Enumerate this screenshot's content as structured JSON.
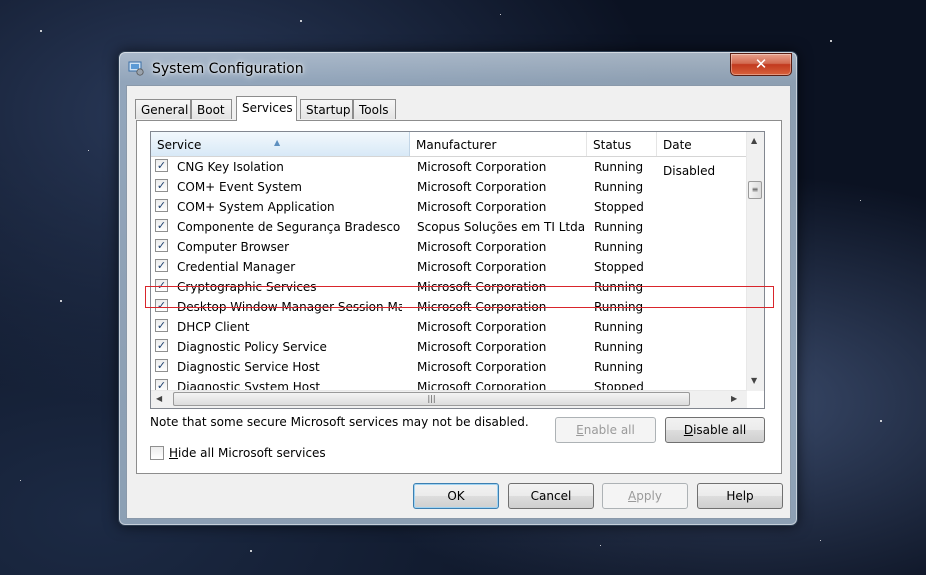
{
  "window": {
    "title": "System Configuration",
    "close_symbol": "✕"
  },
  "tabs": [
    {
      "label": "General",
      "active": false
    },
    {
      "label": "Boot",
      "active": false
    },
    {
      "label": "Services",
      "active": true
    },
    {
      "label": "Startup",
      "active": false
    },
    {
      "label": "Tools",
      "active": false
    }
  ],
  "table": {
    "columns": [
      "Service",
      "Manufacturer",
      "Status",
      "Date Disabled"
    ],
    "sorted_column": "Service",
    "rows": [
      {
        "service": "CNG Key Isolation",
        "manufacturer": "Microsoft Corporation",
        "status": "Running",
        "date_disabled": "",
        "checked": true
      },
      {
        "service": "COM+ Event System",
        "manufacturer": "Microsoft Corporation",
        "status": "Running",
        "date_disabled": "",
        "checked": true
      },
      {
        "service": "COM+ System Application",
        "manufacturer": "Microsoft Corporation",
        "status": "Stopped",
        "date_disabled": "",
        "checked": true
      },
      {
        "service": "Componente de Segurança Bradesco",
        "manufacturer": "Scopus Soluções em TI Ltda",
        "status": "Running",
        "date_disabled": "",
        "checked": true
      },
      {
        "service": "Computer Browser",
        "manufacturer": "Microsoft Corporation",
        "status": "Running",
        "date_disabled": "",
        "checked": true
      },
      {
        "service": "Credential Manager",
        "manufacturer": "Microsoft Corporation",
        "status": "Stopped",
        "date_disabled": "",
        "checked": true
      },
      {
        "service": "Cryptographic Services",
        "manufacturer": "Microsoft Corporation",
        "status": "Running",
        "date_disabled": "",
        "checked": true
      },
      {
        "service": "Desktop Window Manager Session Ma...",
        "manufacturer": "Microsoft Corporation",
        "status": "Running",
        "date_disabled": "",
        "checked": true
      },
      {
        "service": "DHCP Client",
        "manufacturer": "Microsoft Corporation",
        "status": "Running",
        "date_disabled": "",
        "checked": true
      },
      {
        "service": "Diagnostic Policy Service",
        "manufacturer": "Microsoft Corporation",
        "status": "Running",
        "date_disabled": "",
        "checked": true
      },
      {
        "service": "Diagnostic Service Host",
        "manufacturer": "Microsoft Corporation",
        "status": "Running",
        "date_disabled": "",
        "checked": true
      },
      {
        "service": "Diagnostic System Host",
        "manufacturer": "Microsoft Corporation",
        "status": "Stopped",
        "date_disabled": "",
        "checked": true
      }
    ]
  },
  "note": "Note that some secure Microsoft services may not be disabled.",
  "enable_all": {
    "pre": "",
    "mnemonic": "E",
    "post": "nable all"
  },
  "disable_all": {
    "pre": "",
    "mnemonic": "D",
    "post": "isable all"
  },
  "hide_ms": {
    "pre": "",
    "mnemonic": "H",
    "post": "ide all Microsoft services",
    "checked": false
  },
  "buttons": {
    "ok": "OK",
    "cancel": "Cancel",
    "apply_pre": "",
    "apply_mnemonic": "A",
    "apply_post": "pply",
    "help": "Help"
  },
  "highlighted_row": "Componente de Segurança Bradesco",
  "highlight_color": "#d9252b",
  "scroll": {
    "up": "▲",
    "down": "▼",
    "left": "◀",
    "right": "▶",
    "grip_v": "≡",
    "grip_h": "|||"
  },
  "check_glyph": "✓"
}
